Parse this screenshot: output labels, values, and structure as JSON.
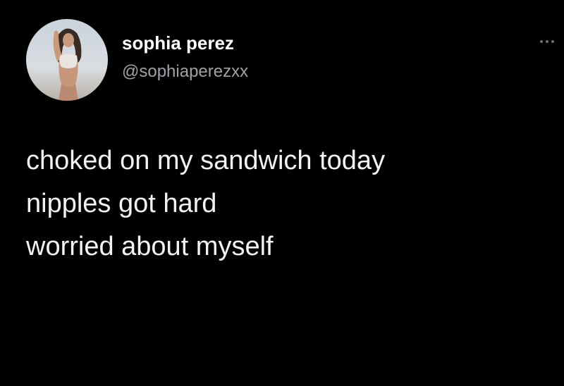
{
  "user": {
    "display_name": "sophia perez",
    "handle": "@sophiaperezxx"
  },
  "tweet": {
    "lines": [
      "choked on my sandwich today",
      "nipples got hard",
      "worried about myself"
    ]
  },
  "icons": {
    "avatar": "profile-photo",
    "more": "more-options-icon"
  },
  "colors": {
    "background": "#000000",
    "text": "#ffffff",
    "handle": "#9ea3a7"
  }
}
